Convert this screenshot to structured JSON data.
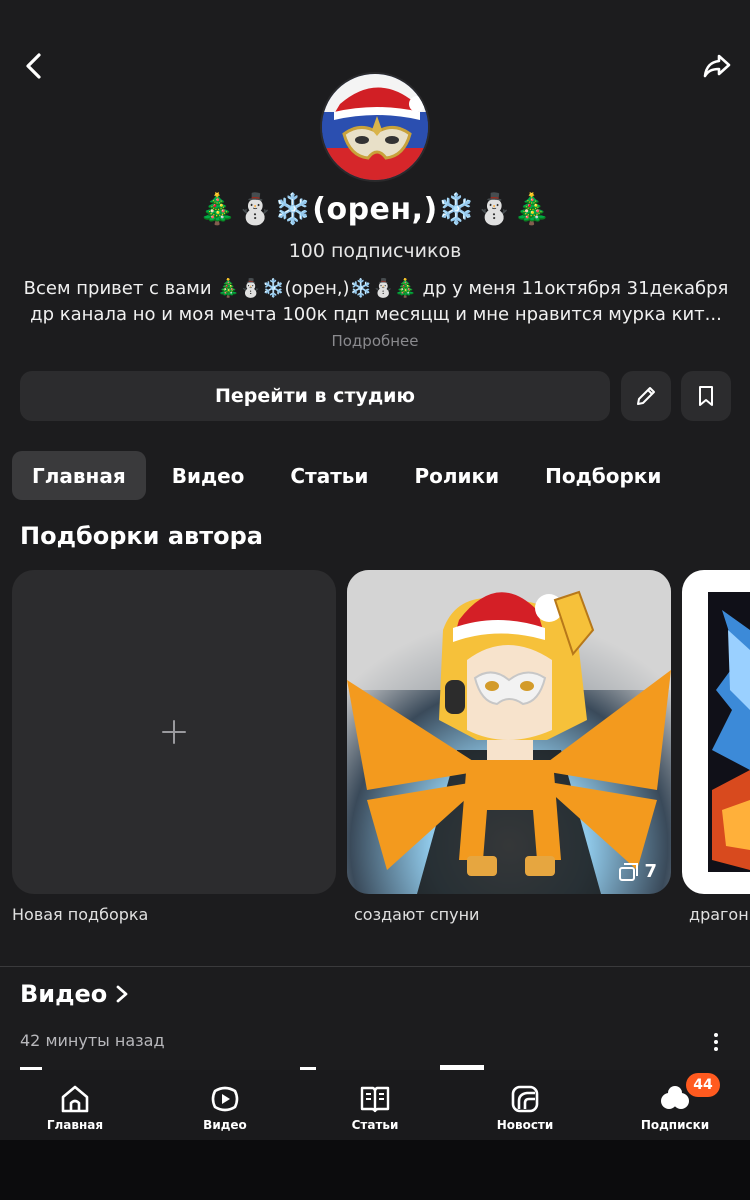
{
  "header": {
    "back_icon": "chevron-left-icon",
    "share_icon": "share-arrow-icon"
  },
  "channel": {
    "name": "🎄⛄❄️(орен,)❄️⛄🎄",
    "subscribers": "100 подписчиков",
    "description_line1": "Всем привет с вами 🎄⛄❄️(орен,)❄️⛄🎄 др у меня 11октября 31декабря",
    "description_line2": "др канала  но и моя мечта 100к пдп месяцщ и мне нравится мурка кит...",
    "more_label": "Подробнее"
  },
  "actions": {
    "studio_label": "Перейти в студию",
    "edit_icon": "pencil-icon",
    "bookmark_icon": "bookmark-icon"
  },
  "tabs": [
    {
      "label": "Главная",
      "active": true
    },
    {
      "label": "Видео",
      "active": false
    },
    {
      "label": "Статьи",
      "active": false
    },
    {
      "label": "Ролики",
      "active": false
    },
    {
      "label": "Подборки",
      "active": false
    }
  ],
  "collections": {
    "title": "Подборки автора",
    "items": [
      {
        "caption": "Новая подборка"
      },
      {
        "caption": "создают спуни",
        "count": "7"
      },
      {
        "caption": "драгонь"
      }
    ]
  },
  "video_section": {
    "title": "Видео",
    "time": "42 минуты назад"
  },
  "bottom_nav": [
    {
      "label": "Главная",
      "icon": "home-icon"
    },
    {
      "label": "Видео",
      "icon": "play-icon"
    },
    {
      "label": "Статьи",
      "icon": "book-icon"
    },
    {
      "label": "Новости",
      "icon": "news-icon"
    },
    {
      "label": "Подписки",
      "icon": "subscriptions-icon",
      "badge": "44"
    }
  ],
  "colors": {
    "background": "#1c1c1e",
    "surface": "#2c2c2e",
    "badge": "#ff5a1f"
  }
}
